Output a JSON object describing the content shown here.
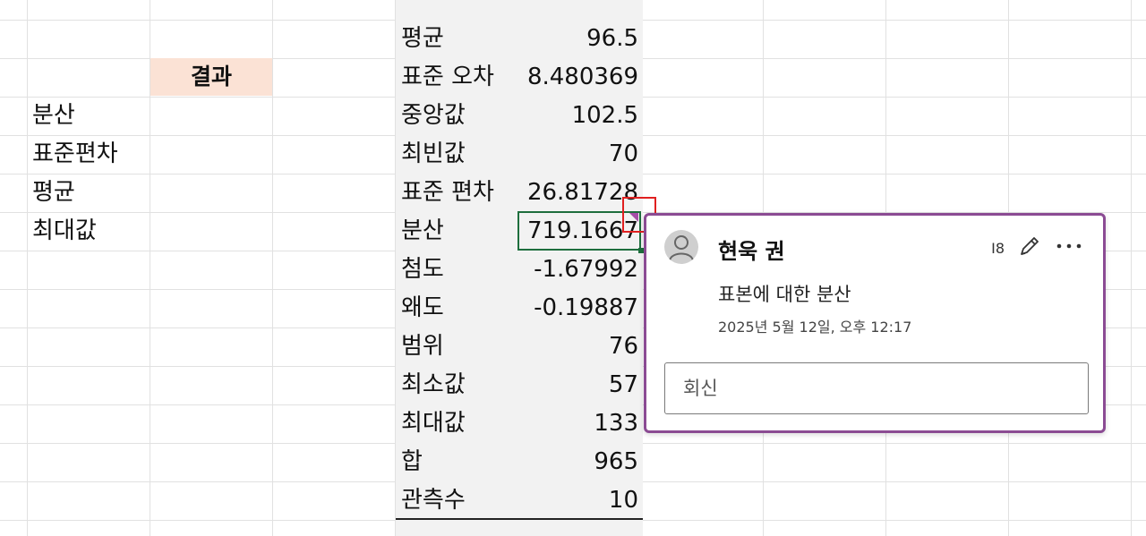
{
  "left_labels": [
    "분산",
    "표준편차",
    "평균",
    "최대값"
  ],
  "result_header": "결과",
  "stats": [
    {
      "name": "평균",
      "value": "96.5"
    },
    {
      "name": "표준 오차",
      "value": "8.480369"
    },
    {
      "name": "중앙값",
      "value": "102.5"
    },
    {
      "name": "최빈값",
      "value": "70"
    },
    {
      "name": "표준 편차",
      "value": "26.81728"
    },
    {
      "name": "분산",
      "value": "719.1667"
    },
    {
      "name": "첨도",
      "value": "-1.67992"
    },
    {
      "name": "왜도",
      "value": "-0.19887"
    },
    {
      "name": "범위",
      "value": "76"
    },
    {
      "name": "최소값",
      "value": "57"
    },
    {
      "name": "최대값",
      "value": "133"
    },
    {
      "name": "합",
      "value": "965"
    },
    {
      "name": "관측수",
      "value": "10"
    }
  ],
  "comment": {
    "author": "현욱 권",
    "text": "표본에 대한 분산",
    "timestamp": "2025년 5월 12일, 오후 12:17",
    "reply_placeholder": "회신",
    "header_badge": "I8",
    "icons": {
      "avatar": "person-icon",
      "edit": "pencil-icon",
      "more": "more-horizontal-icon"
    }
  },
  "colors": {
    "result_header_bg": "#fbe2d5",
    "stats_bg": "#f2f2f2",
    "selection_border": "#1e6e3d",
    "comment_border": "#8b4b93",
    "highlight_marker": "#e02020"
  }
}
